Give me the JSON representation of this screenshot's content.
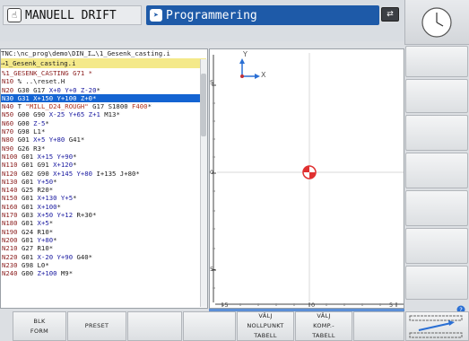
{
  "header": {
    "mode_manual": "MANUELL DRIFT",
    "mode_programming": "Programmering"
  },
  "program": {
    "path": "TNC:\\nc_prog\\demo\\DIN_I…\\1_Gesenk_casting.i",
    "file": "→1_Gesenk_casting.i",
    "lines": [
      [
        [
          "%1_GESENK_CASTING G71 *",
          "c-n"
        ]
      ],
      [
        [
          "N10 ",
          "c-n"
        ],
        [
          "% ..\\reset.H",
          "c-k"
        ]
      ],
      [
        [
          "N20 ",
          "c-n"
        ],
        [
          "G30 G17 ",
          "c-k"
        ],
        [
          "X+0 ",
          "c-x"
        ],
        [
          "Y+0 ",
          "c-y"
        ],
        [
          "Z-20",
          "c-z"
        ],
        [
          "*",
          "c-k"
        ]
      ],
      [
        [
          "N30 ",
          "c-n"
        ],
        [
          "G31 ",
          "c-k"
        ],
        [
          "X+150 ",
          "c-x"
        ],
        [
          "Y+100 ",
          "c-y"
        ],
        [
          "Z+0",
          "c-z"
        ],
        [
          "*",
          "c-k"
        ]
      ],
      [
        [
          "N40 ",
          "c-n"
        ],
        [
          "T ",
          "c-k"
        ],
        [
          "\"MILL_D24_ROUGH\" ",
          "c-t"
        ],
        [
          "G17 S1800 ",
          "c-k"
        ],
        [
          "F400",
          "c-t"
        ],
        [
          "*",
          "c-k"
        ]
      ],
      [
        [
          "N50 ",
          "c-n"
        ],
        [
          "G00 G90 ",
          "c-k"
        ],
        [
          "X-25 ",
          "c-x"
        ],
        [
          "Y+65 ",
          "c-y"
        ],
        [
          "Z+1 ",
          "c-z"
        ],
        [
          "M13",
          "c-k"
        ],
        [
          "*",
          "c-k"
        ]
      ],
      [
        [
          "N60 ",
          "c-n"
        ],
        [
          "G00 ",
          "c-k"
        ],
        [
          "Z-5",
          "c-z"
        ],
        [
          "*",
          "c-k"
        ]
      ],
      [
        [
          "N70 ",
          "c-n"
        ],
        [
          "G98 L1",
          "c-k"
        ],
        [
          "*",
          "c-k"
        ]
      ],
      [
        [
          "N80 ",
          "c-n"
        ],
        [
          "G01 ",
          "c-k"
        ],
        [
          "X+5 ",
          "c-x"
        ],
        [
          "Y+80 ",
          "c-y"
        ],
        [
          "G41",
          "c-k"
        ],
        [
          "*",
          "c-k"
        ]
      ],
      [
        [
          "N90 ",
          "c-n"
        ],
        [
          "G26 R3",
          "c-k"
        ],
        [
          "*",
          "c-k"
        ]
      ],
      [
        [
          "N100 ",
          "c-n"
        ],
        [
          "G01 ",
          "c-k"
        ],
        [
          "X+15 ",
          "c-x"
        ],
        [
          "Y+90",
          "c-y"
        ],
        [
          "*",
          "c-k"
        ]
      ],
      [
        [
          "N110 ",
          "c-n"
        ],
        [
          "G01 G91 ",
          "c-k"
        ],
        [
          "X+120",
          "c-x"
        ],
        [
          "*",
          "c-k"
        ]
      ],
      [
        [
          "N120 ",
          "c-n"
        ],
        [
          "G02 G90 ",
          "c-k"
        ],
        [
          "X+145 ",
          "c-x"
        ],
        [
          "Y+80 ",
          "c-y"
        ],
        [
          "I+135 J+80",
          "c-k"
        ],
        [
          "*",
          "c-k"
        ]
      ],
      [
        [
          "N130 ",
          "c-n"
        ],
        [
          "G01 ",
          "c-k"
        ],
        [
          "Y+50",
          "c-y"
        ],
        [
          "*",
          "c-k"
        ]
      ],
      [
        [
          "N140 ",
          "c-n"
        ],
        [
          "G25 R20",
          "c-k"
        ],
        [
          "*",
          "c-k"
        ]
      ],
      [
        [
          "N150 ",
          "c-n"
        ],
        [
          "G01 ",
          "c-k"
        ],
        [
          "X+130 ",
          "c-x"
        ],
        [
          "Y+5",
          "c-y"
        ],
        [
          "*",
          "c-k"
        ]
      ],
      [
        [
          "N160 ",
          "c-n"
        ],
        [
          "G01 ",
          "c-k"
        ],
        [
          "X+100",
          "c-x"
        ],
        [
          "*",
          "c-k"
        ]
      ],
      [
        [
          "N170 ",
          "c-n"
        ],
        [
          "G03 ",
          "c-k"
        ],
        [
          "X+50 ",
          "c-x"
        ],
        [
          "Y+12 ",
          "c-y"
        ],
        [
          "R+30",
          "c-k"
        ],
        [
          "*",
          "c-k"
        ]
      ],
      [
        [
          "N180 ",
          "c-n"
        ],
        [
          "G01 ",
          "c-k"
        ],
        [
          "X+5",
          "c-x"
        ],
        [
          "*",
          "c-k"
        ]
      ],
      [
        [
          "N190 ",
          "c-n"
        ],
        [
          "G24 R10",
          "c-k"
        ],
        [
          "*",
          "c-k"
        ]
      ],
      [
        [
          "N200 ",
          "c-n"
        ],
        [
          "G01 ",
          "c-k"
        ],
        [
          "Y+80",
          "c-y"
        ],
        [
          "*",
          "c-k"
        ]
      ],
      [
        [
          "N210 ",
          "c-n"
        ],
        [
          "G27 R10",
          "c-k"
        ],
        [
          "*",
          "c-k"
        ]
      ],
      [
        [
          "N220 ",
          "c-n"
        ],
        [
          "G01 ",
          "c-k"
        ],
        [
          "X-20 ",
          "c-x"
        ],
        [
          "Y+90 ",
          "c-y"
        ],
        [
          "G40",
          "c-k"
        ],
        [
          "*",
          "c-k"
        ]
      ],
      [
        [
          "N230 ",
          "c-n"
        ],
        [
          "G98 L0",
          "c-k"
        ],
        [
          "*",
          "c-k"
        ]
      ],
      [
        [
          "N240 ",
          "c-n"
        ],
        [
          "G00 ",
          "c-k"
        ],
        [
          "Z+100 ",
          "c-z"
        ],
        [
          "M9",
          "c-k"
        ],
        [
          "*",
          "c-k"
        ]
      ]
    ],
    "selected_line": 3
  },
  "graphics": {
    "axis_y": "Y",
    "axis_x": "X",
    "left_ruler": {
      "top": "5",
      "mid": "0",
      "bottom": "5-"
    },
    "bottom_ruler": {
      "left": "-5",
      "mid": "0",
      "right": "5"
    }
  },
  "softkeys": {
    "k1_line1": "BLK",
    "k1_line2": "FORM",
    "k2": "PRESET",
    "k5_line1": "VÄLJ",
    "k5_line2": "NOLLPUNKT",
    "k5_line3": "TABELL",
    "k6_line1": "VÄLJ",
    "k6_line2": "KOMP.-",
    "k6_line3": "TABELL"
  },
  "colors": {
    "tab_active": "#1e5aa8",
    "selection": "#1464d2",
    "file_highlight": "#f4e98a",
    "origin_marker": "#e03030"
  }
}
